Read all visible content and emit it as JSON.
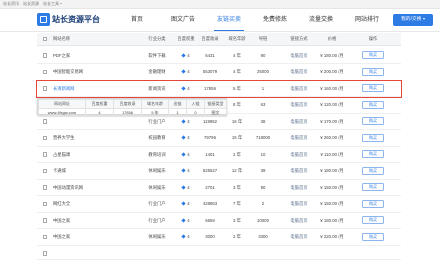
{
  "topbar": {
    "links": [
      "站长资讯",
      "站长资源",
      "站长工具"
    ]
  },
  "header": {
    "logo_text": "站长资源平台",
    "nav": [
      {
        "label": "首页"
      },
      {
        "label": "图文广告"
      },
      {
        "label": "友链买卖",
        "active": true
      },
      {
        "label": "免费修炼"
      },
      {
        "label": "流量交换"
      },
      {
        "label": "网站排行"
      }
    ],
    "account_button": "我的/交换"
  },
  "table": {
    "columns": [
      "网站名称",
      "行业分类",
      "百度权重",
      "百度收录",
      "域名年龄",
      "导链",
      "链接方式",
      "价格",
      "操作"
    ],
    "rows": [
      {
        "name": "PDF之家",
        "category": "软件下载",
        "weight": "4",
        "indexed": "6431",
        "age": "4 年",
        "links": "90",
        "method": "电脑首页",
        "price": "¥ 180.00 /月",
        "action": "购买"
      },
      {
        "name": "中国智能交易网",
        "category": "金融理财",
        "weight": "4",
        "indexed": "553079",
        "age": "4 年",
        "links": "25000",
        "method": "电脑首页",
        "price": "¥ 200.00 /月",
        "action": "购买"
      },
      {
        "name": "长清新闻网",
        "category": "新闻资讯",
        "weight": "4",
        "indexed": "17856",
        "age": "5 年",
        "links": "1",
        "method": "电脑首页",
        "price": "¥ 160.00 /月",
        "action": "购买",
        "hovered": true
      },
      {
        "age": "8 年",
        "links": "63",
        "method": "电脑首页",
        "price": "¥ 120.00 /月",
        "action": "购买"
      },
      {
        "category": "行业门户",
        "weight": "4",
        "indexed": "119952",
        "age": "16 年",
        "links": "38",
        "method": "电脑首页",
        "price": "¥ 170.00 /月",
        "action": "购买"
      },
      {
        "name": "营养大学生",
        "category": "校园教育",
        "weight": "4",
        "indexed": "79796",
        "age": "15 年",
        "links": "718000",
        "method": "电脑首页",
        "price": "¥ 260.00 /月",
        "action": "购买"
      },
      {
        "name": "占星猫课",
        "category": "教育培训",
        "weight": "4",
        "indexed": "1401",
        "age": "2 年",
        "links": "10",
        "method": "电脑首页",
        "price": "¥ 110.00 /月",
        "action": "购买"
      },
      {
        "name": "卡通城",
        "category": "休闲娱乐",
        "weight": "4",
        "indexed": "525627",
        "age": "12 年",
        "links": "39",
        "method": "电脑首页",
        "price": "¥ 180.00 /月",
        "action": "购买"
      },
      {
        "name": "中国动漫资讯网",
        "category": "休闲娱乐",
        "weight": "4",
        "indexed": "2701",
        "age": "3 年",
        "links": "90",
        "method": "电脑首页",
        "price": "¥ 150.00 /月",
        "action": "购买"
      },
      {
        "name": "网红大全",
        "category": "行业门户",
        "weight": "4",
        "indexed": "428863",
        "age": "7 年",
        "links": "2",
        "method": "电脑首页",
        "price": "¥ 150.00 /月",
        "action": "购买"
      },
      {
        "name": "中国之家",
        "category": "行业门户",
        "weight": "4",
        "indexed": "6659",
        "age": "3 年",
        "links": "10000",
        "method": "电脑首页",
        "price": "¥ 180.00 /月",
        "action": "购买"
      },
      {
        "name": "中国之家",
        "category": "休闲娱乐",
        "weight": "4",
        "indexed": "3000",
        "age": "2 年",
        "links": "3300",
        "method": "电脑首页",
        "price": "¥ 220.00 /月",
        "action": "购买"
      },
      {}
    ]
  },
  "tooltip": {
    "columns": [
      "网站网址",
      "百度权重",
      "百度收录",
      "域名年龄",
      "出链",
      "入链",
      "链接类型"
    ],
    "values": [
      "www.4fsgw.com",
      "4",
      "17856",
      "5 年",
      "1",
      "0",
      "图文"
    ]
  },
  "icons": {
    "logo": "site-logo-icon",
    "weight": "baidu-weight-icon",
    "dropdown": "chevron-down-icon"
  },
  "colors": {
    "accent": "#2d7be5",
    "hover_outline": "#e5473b",
    "header_bg": "#f5f6f8"
  }
}
